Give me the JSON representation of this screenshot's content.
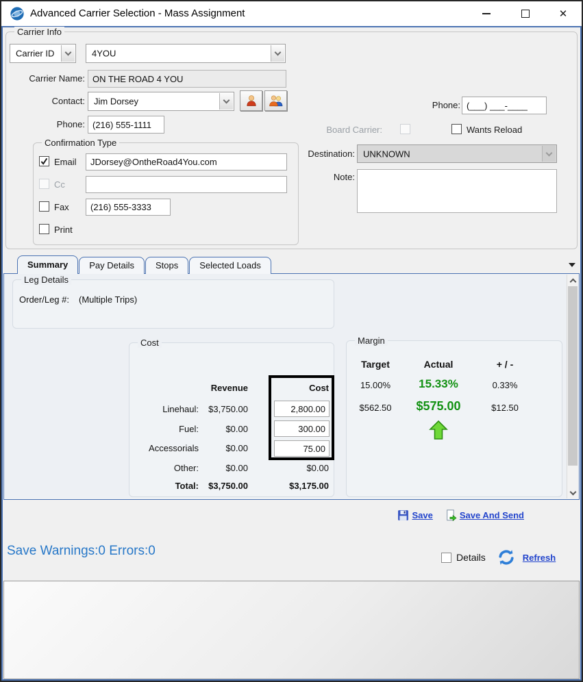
{
  "window": {
    "title": "Advanced Carrier Selection - Mass Assignment"
  },
  "icons": {
    "app": "blue-globe",
    "minimize": "bar",
    "maximize": "box",
    "close": "✕",
    "chevron": "chevron-down",
    "check": "checkmark",
    "contact_single": "person",
    "contact_group": "two-people",
    "save": "floppy-disk",
    "save_and_send": "document-green-arrow",
    "refresh": "blue-circular-arrows",
    "margin_indicator": "green-up-arrow",
    "tab_overflow": "black-down-triangle"
  },
  "carrier_info": {
    "group_label": "Carrier Info",
    "id_selector_value": "Carrier ID",
    "id_value": "4YOU",
    "name_label": "Carrier Name:",
    "name_value": "ON THE ROAD 4 YOU",
    "contact_label": "Contact:",
    "contact_value": "Jim Dorsey",
    "phone_label": "Phone:",
    "phone_value": "(216) 555-1111",
    "phone2_label": "Phone:",
    "phone2_value": "(___) ___-____",
    "board_carrier_label": "Board Carrier:",
    "wants_reload_label": "Wants Reload",
    "destination_label": "Destination:",
    "destination_value": "UNKNOWN",
    "note_label": "Note:",
    "note_value": "",
    "confirmation": {
      "group_label": "Confirmation Type",
      "email_label": "Email",
      "email_value": "JDorsey@OntheRoad4You.com",
      "cc_label": "Cc",
      "cc_value": "",
      "fax_label": "Fax",
      "fax_value": "(216) 555-3333",
      "print_label": "Print"
    }
  },
  "tabs": {
    "items": [
      {
        "label": "Summary",
        "selected": true
      },
      {
        "label": "Pay Details",
        "selected": false
      },
      {
        "label": "Stops",
        "selected": false
      },
      {
        "label": "Selected Loads",
        "selected": false
      }
    ]
  },
  "summary_tab": {
    "leg_details": {
      "group_label": "Leg Details",
      "order_leg_label": "Order/Leg #:",
      "order_leg_value": "(Multiple Trips)"
    },
    "cost": {
      "group_label": "Cost",
      "revenue_header": "Revenue",
      "cost_header": "Cost",
      "rows": [
        {
          "label": "Linehaul:",
          "revenue": "$3,750.00",
          "cost": "2,800.00"
        },
        {
          "label": "Fuel:",
          "revenue": "$0.00",
          "cost": "300.00"
        },
        {
          "label": "Accessorials",
          "revenue": "$0.00",
          "cost": "75.00"
        },
        {
          "label": "Other:",
          "revenue": "$0.00",
          "cost": "$0.00"
        },
        {
          "label": "Total:",
          "revenue": "$3,750.00",
          "cost": "$3,175.00"
        }
      ]
    },
    "margin": {
      "group_label": "Margin",
      "headers": [
        "Target",
        "Actual",
        "+ / -"
      ],
      "percent_row": [
        "15.00%",
        "15.33%",
        "0.33%"
      ],
      "dollar_row": [
        "$562.50",
        "$575.00",
        "$12.50"
      ]
    }
  },
  "footer": {
    "save_label": "Save",
    "save_and_send_label": "Save And Send",
    "status_text": "Save Warnings:0 Errors:0",
    "details_label": "Details",
    "refresh_label": "Refresh"
  },
  "colors": {
    "accent_blue": "#4a72b2",
    "link_blue": "#2244cc",
    "status_blue": "#2878c8",
    "positive_green": "#129112",
    "arrow_green": "#6fd838"
  }
}
